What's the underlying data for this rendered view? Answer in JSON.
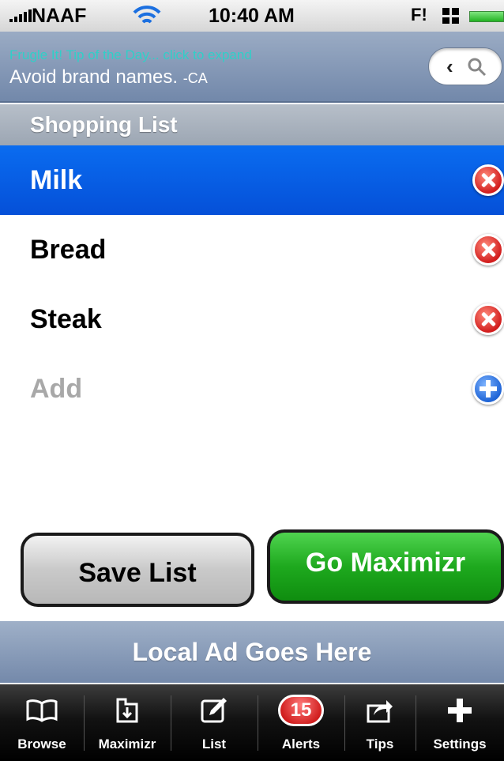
{
  "status_bar": {
    "carrier": "NAAF",
    "time": "10:40 AM",
    "right_text": "F!"
  },
  "tip": {
    "label": "Frugle It! Tip of the Day... click to expand",
    "text": "Avoid brand names.",
    "author": "-CA"
  },
  "search": {
    "back_icon": "chevron-left-icon",
    "search_icon": "magnifier-icon"
  },
  "section_title": "Shopping List",
  "list": {
    "items": [
      {
        "label": "Milk",
        "selected": true
      },
      {
        "label": "Bread",
        "selected": false
      },
      {
        "label": "Steak",
        "selected": false
      }
    ],
    "add_label": "Add"
  },
  "buttons": {
    "save_label": "Save List",
    "go_label": "Go Maximizr"
  },
  "ad_text": "Local Ad Goes Here",
  "tabs": [
    {
      "label": "Browse",
      "icon": "book-icon"
    },
    {
      "label": "Maximizr",
      "icon": "maximizr-icon"
    },
    {
      "label": "List",
      "icon": "edit-icon"
    },
    {
      "label": "Alerts",
      "icon": "badge-icon",
      "badge": "15"
    },
    {
      "label": "Tips",
      "icon": "share-icon"
    },
    {
      "label": "Settings",
      "icon": "plus-icon"
    }
  ],
  "colors": {
    "selected_row": "#0a6cf0",
    "go_button": "#1ea91e",
    "tip_label": "#2fd0c8",
    "badge": "#d01e1e"
  }
}
